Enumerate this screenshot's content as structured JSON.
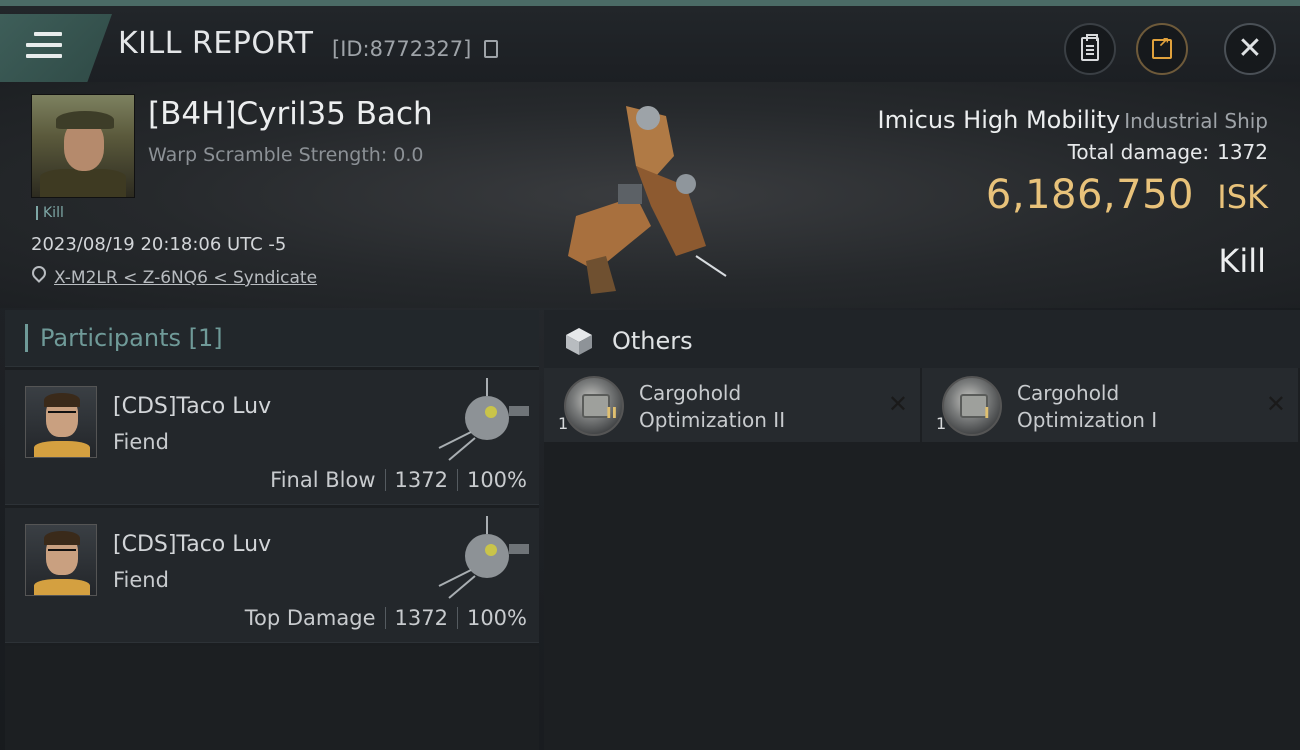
{
  "header": {
    "title": "KILL REPORT",
    "report_id": "[ID:8772327]"
  },
  "victim": {
    "name": "[B4H]Cyril35 Bach",
    "warp_scramble": "Warp Scramble Strength: 0.0",
    "kill_tag": "Kill",
    "datetime": "2023/08/19 20:18:06 UTC -5",
    "location": "X-M2LR < Z-6NQ6 < Syndicate",
    "ship_name": "Imicus High Mobility",
    "ship_class": "Industrial Ship",
    "total_damage_label": "Total damage:",
    "total_damage": "1372",
    "isk_value": "6,186,750",
    "isk_unit": "ISK",
    "result": "Kill"
  },
  "participants": {
    "title": "Participants",
    "count": "[1]",
    "rows": [
      {
        "name": "[CDS]Taco Luv",
        "ship": "Fiend",
        "role": "Final Blow",
        "damage": "1372",
        "percent": "100%"
      },
      {
        "name": "[CDS]Taco Luv",
        "ship": "Fiend",
        "role": "Top Damage",
        "damage": "1372",
        "percent": "100%"
      }
    ]
  },
  "others": {
    "title": "Others",
    "items": [
      {
        "name_line1": "Cargohold",
        "name_line2": "Optimization II",
        "qty": "1",
        "tier": "II"
      },
      {
        "name_line1": "Cargohold",
        "name_line2": "Optimization I",
        "qty": "1",
        "tier": "I"
      }
    ]
  },
  "colors": {
    "accent": "#6f9a98",
    "isk": "#e8c27a",
    "share_button": "#e0a13c"
  },
  "icons": [
    "menu-icon",
    "copy-icon",
    "clipboard-icon",
    "share-icon",
    "close-icon",
    "location-pin-icon",
    "cube-icon",
    "drop-x-icon"
  ]
}
